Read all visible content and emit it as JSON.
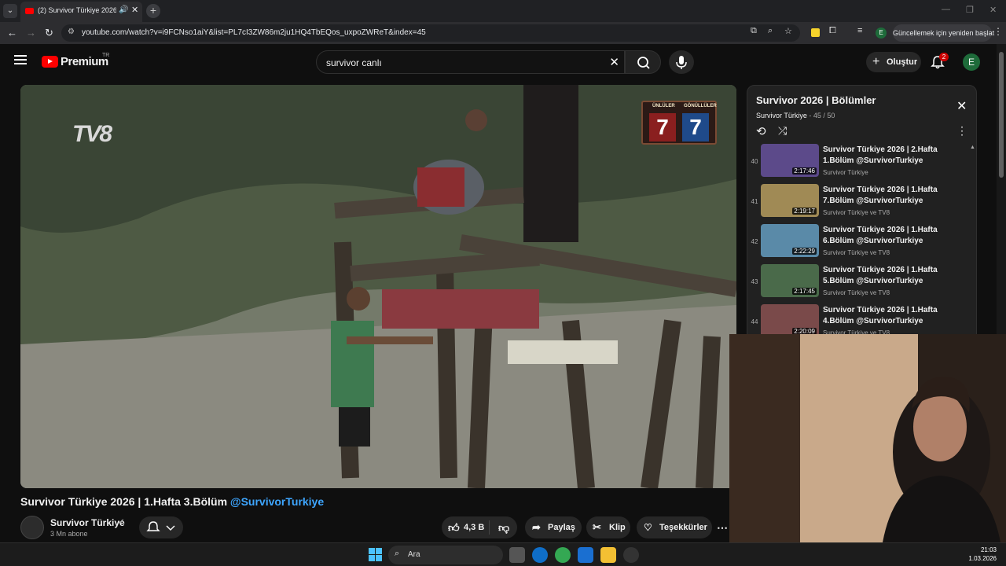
{
  "browser": {
    "tab_title": "(2) Survivor Türkiye 2026 | ",
    "url": "youtube.com/watch?v=i9FCNso1aiY&list=PL7cI3ZW86m2ju1HQ4TbEQos_uxpoZWReT&index=45",
    "update_button": "Güncellemek için yeniden başlat",
    "profile_letter": "E"
  },
  "header": {
    "brand": "Premium",
    "region": "TR",
    "search_query": "survivor canlı",
    "create_label": "Oluştur",
    "notification_count": "2",
    "avatar_letter": "E"
  },
  "video": {
    "channel_logo": "TV8",
    "score": {
      "team_left": "ÜNLÜLER",
      "team_right": "GÖNÜLLÜLER",
      "value_left": "7",
      "value_right": "7"
    },
    "title_main": "Survivor Türkiye 2026 | 1.Hafta 3.Bölüm ",
    "title_tag": "@SurvivorTurkiye",
    "channel_name": "Survivor Türkiye",
    "subscribers": "3 Mn abone",
    "likes": "4,3 B",
    "share_label": "Paylaş",
    "clip_label": "Klip",
    "thanks_label": "Teşekkürler"
  },
  "playlist": {
    "title": "Survivor 2026 | Bölümler",
    "channel": "Survivor Türkiye",
    "position": " - 45 / 50",
    "items": [
      {
        "index": "40",
        "title": "Survivor Türkiye 2026 | 2.Hafta 1.Bölüm @SurvivorTurkiye",
        "channel": "Survivor Türkiye",
        "duration": "2:17:46",
        "color": "#5c4a8a"
      },
      {
        "index": "41",
        "title": "Survivor Türkiye 2026 | 1.Hafta 7.Bölüm @SurvivorTurkiye",
        "channel": "Survivor Türkiye ve TV8",
        "duration": "2:19:17",
        "color": "#a08a55"
      },
      {
        "index": "42",
        "title": "Survivor Türkiye 2026 | 1.Hafta 6.Bölüm @SurvivorTurkiye",
        "channel": "Survivor Türkiye ve TV8",
        "duration": "2:22:29",
        "color": "#5a8aa8"
      },
      {
        "index": "43",
        "title": "Survivor Türkiye 2026 | 1.Hafta 5.Bölüm @SurvivorTurkiye",
        "channel": "Survivor Türkiye ve TV8",
        "duration": "2:17:45",
        "color": "#4a6a4a"
      },
      {
        "index": "44",
        "title": "Survivor Türkiye 2026 | 1.Hafta 4.Bölüm @SurvivorTurkiye",
        "channel": "Survivor Türkiye ve TV8",
        "duration": "2:20:09",
        "color": "#7a4a4a"
      }
    ]
  },
  "taskbar": {
    "search_label": "Ara",
    "time": "21:03",
    "date": "1.03.2026"
  }
}
